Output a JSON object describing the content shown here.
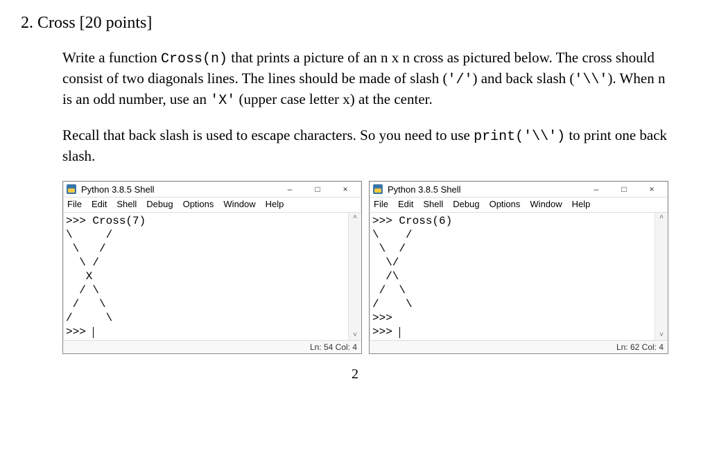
{
  "problem": {
    "number": "2.",
    "title": "Cross [20 points]",
    "para1_pre": "Write a function ",
    "para1_code1": "Cross(n)",
    "para1_mid1": " that prints a picture of an n x n cross as pictured below. The cross should consist of two diagonals lines. The lines should be made of slash (",
    "para1_code2": "'/'",
    "para1_mid2": ") and back slash (",
    "para1_code3": "'\\\\'",
    "para1_mid3": "). When n is an odd number, use an ",
    "para1_code4": "'X'",
    "para1_mid4": " (upper case letter x) at the center.",
    "para2_pre": "Recall that back slash is used to escape characters. So you need to use ",
    "para2_code1": "print('\\\\')",
    "para2_post": " to print one back slash."
  },
  "shell_left": {
    "title": "Python 3.8.5 Shell",
    "menu": [
      "File",
      "Edit",
      "Shell",
      "Debug",
      "Options",
      "Window",
      "Help"
    ],
    "content": ">>> Cross(7)\n\\     /\n \\   /\n  \\ /\n   X\n  / \\\n /   \\\n/     \\\n>>> ",
    "status": "Ln: 54   Col: 4"
  },
  "shell_right": {
    "title": "Python 3.8.5 Shell",
    "menu": [
      "File",
      "Edit",
      "Shell",
      "Debug",
      "Options",
      "Window",
      "Help"
    ],
    "content": ">>> Cross(6)\n\\    /\n \\  /\n  \\/\n  /\\\n /  \\\n/    \\\n>>> \n>>> ",
    "status": "Ln: 62   Col: 4"
  },
  "page_number": "2",
  "win_controls": {
    "min": "–",
    "max": "□",
    "close": "×"
  }
}
